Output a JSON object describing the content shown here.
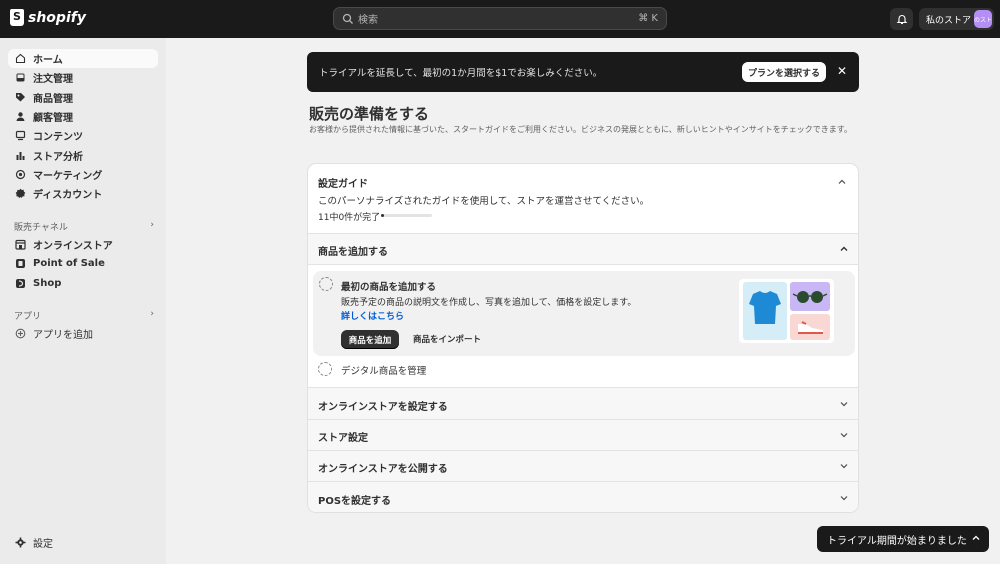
{
  "topbar": {
    "logo_text": "shopify",
    "search_placeholder": "検索",
    "search_shortcut": "⌘ K",
    "store_name": "私のストア",
    "avatar_text": "のスト"
  },
  "sidebar": {
    "items": [
      {
        "label": "ホーム",
        "icon": "home-icon"
      },
      {
        "label": "注文管理",
        "icon": "inbox-icon"
      },
      {
        "label": "商品管理",
        "icon": "tag-icon"
      },
      {
        "label": "顧客管理",
        "icon": "person-icon"
      },
      {
        "label": "コンテンツ",
        "icon": "content-icon"
      },
      {
        "label": "ストア分析",
        "icon": "bar-chart-icon"
      },
      {
        "label": "マーケティング",
        "icon": "target-icon"
      },
      {
        "label": "ディスカウント",
        "icon": "discount-icon"
      }
    ],
    "sales_channels_heading": "販売チャネル",
    "channels": [
      {
        "label": "オンラインストア",
        "icon": "store-icon"
      },
      {
        "label": "Point of Sale",
        "icon": "pos-icon"
      },
      {
        "label": "Shop",
        "icon": "shop-icon"
      }
    ],
    "apps_heading": "アプリ",
    "add_app": "アプリを追加",
    "settings": "設定"
  },
  "banner": {
    "text": "トライアルを延長して、最初の1か月間を$1でお楽しみください。",
    "button": "プランを選択する"
  },
  "page": {
    "title": "販売の準備をする",
    "description": "お客様から提供された情報に基づいた、スタートガイドをご利用ください。ビジネスの発展とともに、新しいヒントやインサイトをチェックできます。"
  },
  "guide": {
    "title": "設定ガイド",
    "subtitle": "このパーソナライズされたガイドを使用して、ストアを運営させてください。",
    "progress_text": "11中0件が完了",
    "progress_fraction": 0.0,
    "sections": [
      {
        "label": "商品を追加する",
        "expanded": true
      },
      {
        "label": "オンラインストアを設定する",
        "expanded": false
      },
      {
        "label": "ストア設定",
        "expanded": false
      },
      {
        "label": "オンラインストアを公開する",
        "expanded": false
      },
      {
        "label": "POSを設定する",
        "expanded": false
      }
    ],
    "task": {
      "title": "最初の商品を追加する",
      "description": "販売予定の商品の説明文を作成し、写真を追加して、価格を設定します。",
      "link": "詳しくはこちら",
      "primary_button": "商品を追加",
      "secondary_button": "商品をインポート"
    },
    "task2": "デジタル商品を管理"
  },
  "toast": {
    "text": "トライアル期間が始まりました"
  }
}
